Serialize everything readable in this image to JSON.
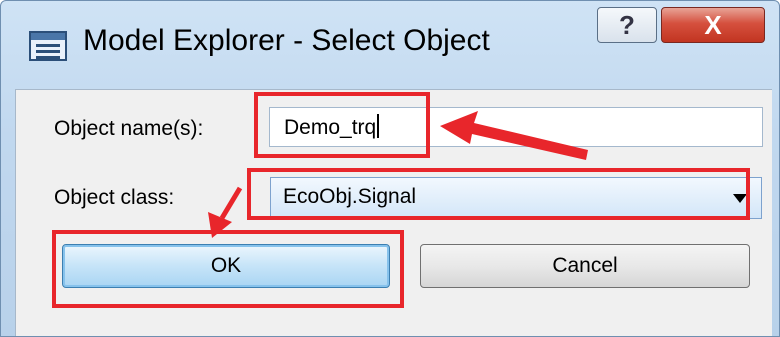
{
  "window": {
    "title": "Model Explorer - Select Object",
    "help_glyph": "?",
    "close_glyph": "X"
  },
  "form": {
    "name_label": "Object name(s):",
    "name_value": "Demo_trq",
    "class_label": "Object class:",
    "class_value": "EcoObj.Signal"
  },
  "buttons": {
    "ok": "OK",
    "cancel": "Cancel"
  },
  "annotations": {
    "color": "#e8262b"
  }
}
